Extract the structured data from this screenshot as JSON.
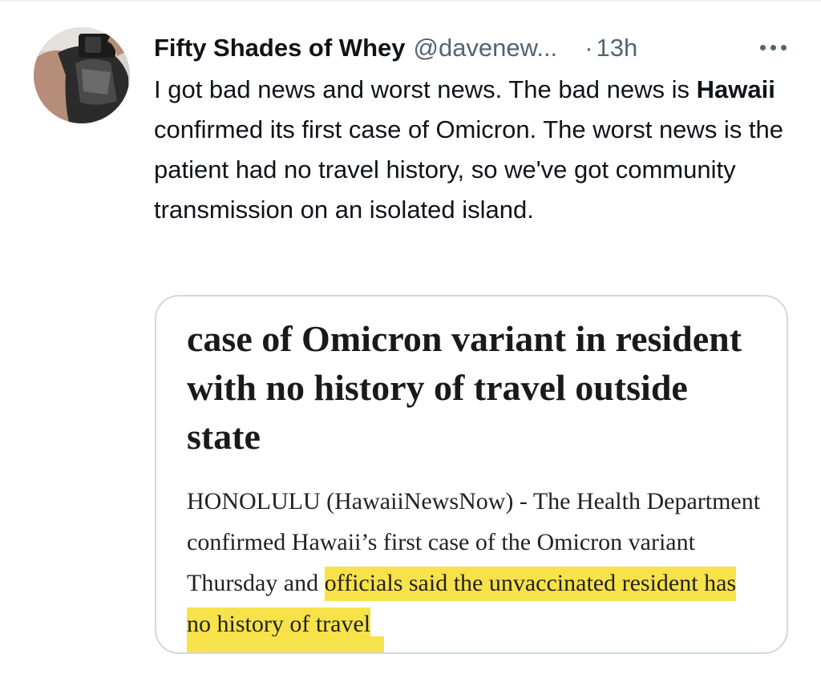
{
  "tweet": {
    "display_name": "Fifty Shades of Whey",
    "handle": "@davenew...",
    "separator": "·",
    "timestamp": "13h",
    "text_before_bold": "I got bad news and worst news. The bad news is ",
    "text_bold": "Hawaii",
    "text_after_bold": " confirmed its first case of Omicron. The worst news is the patient had no travel history, so we've got community transmission on an isolated island."
  },
  "icons": {
    "more": "more-horizontal-icon",
    "avatar": "profile-avatar"
  },
  "card": {
    "headline": "case of Omicron variant in resident with no history of travel outside state",
    "body_plain": "HONOLULU (HawaiiNewsNow) - The Health Department confirmed Hawaii’s first case of the Omicron variant Thursday and ",
    "body_highlighted": "officials said the unvaccinated resident has no history of travel"
  },
  "colors": {
    "text_primary": "#0f1419",
    "text_secondary": "#536471",
    "card_border": "#cfd9de",
    "highlight": "#f7e24a"
  }
}
